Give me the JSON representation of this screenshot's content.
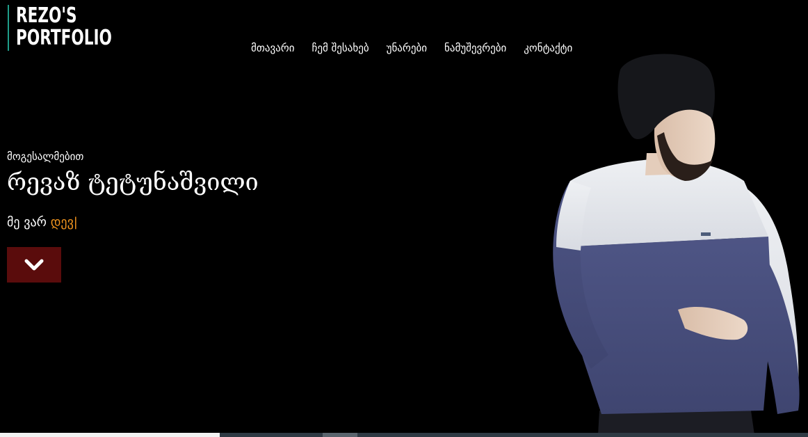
{
  "logo": {
    "line1": "REZO'S",
    "line2": "PORTFOLIO",
    "accent_color": "#1f9e8a"
  },
  "nav": {
    "items": [
      {
        "label": "მთავარი"
      },
      {
        "label": "ჩემ შესახებ"
      },
      {
        "label": "უნარები"
      },
      {
        "label": "ნამუშევრები"
      },
      {
        "label": "კონტაქტი"
      }
    ]
  },
  "hero": {
    "greeting": "მოგესალმებით",
    "name": "რევაზ ტეტუნაშვილი",
    "role_prefix": "მე ვარ",
    "role": "დევ",
    "cursor": "|",
    "role_color": "#f0941e",
    "scroll_button_icon": "chevron-down-icon",
    "scroll_button_color": "#5a0c0c"
  },
  "portrait": {
    "icon": "person-photo"
  }
}
